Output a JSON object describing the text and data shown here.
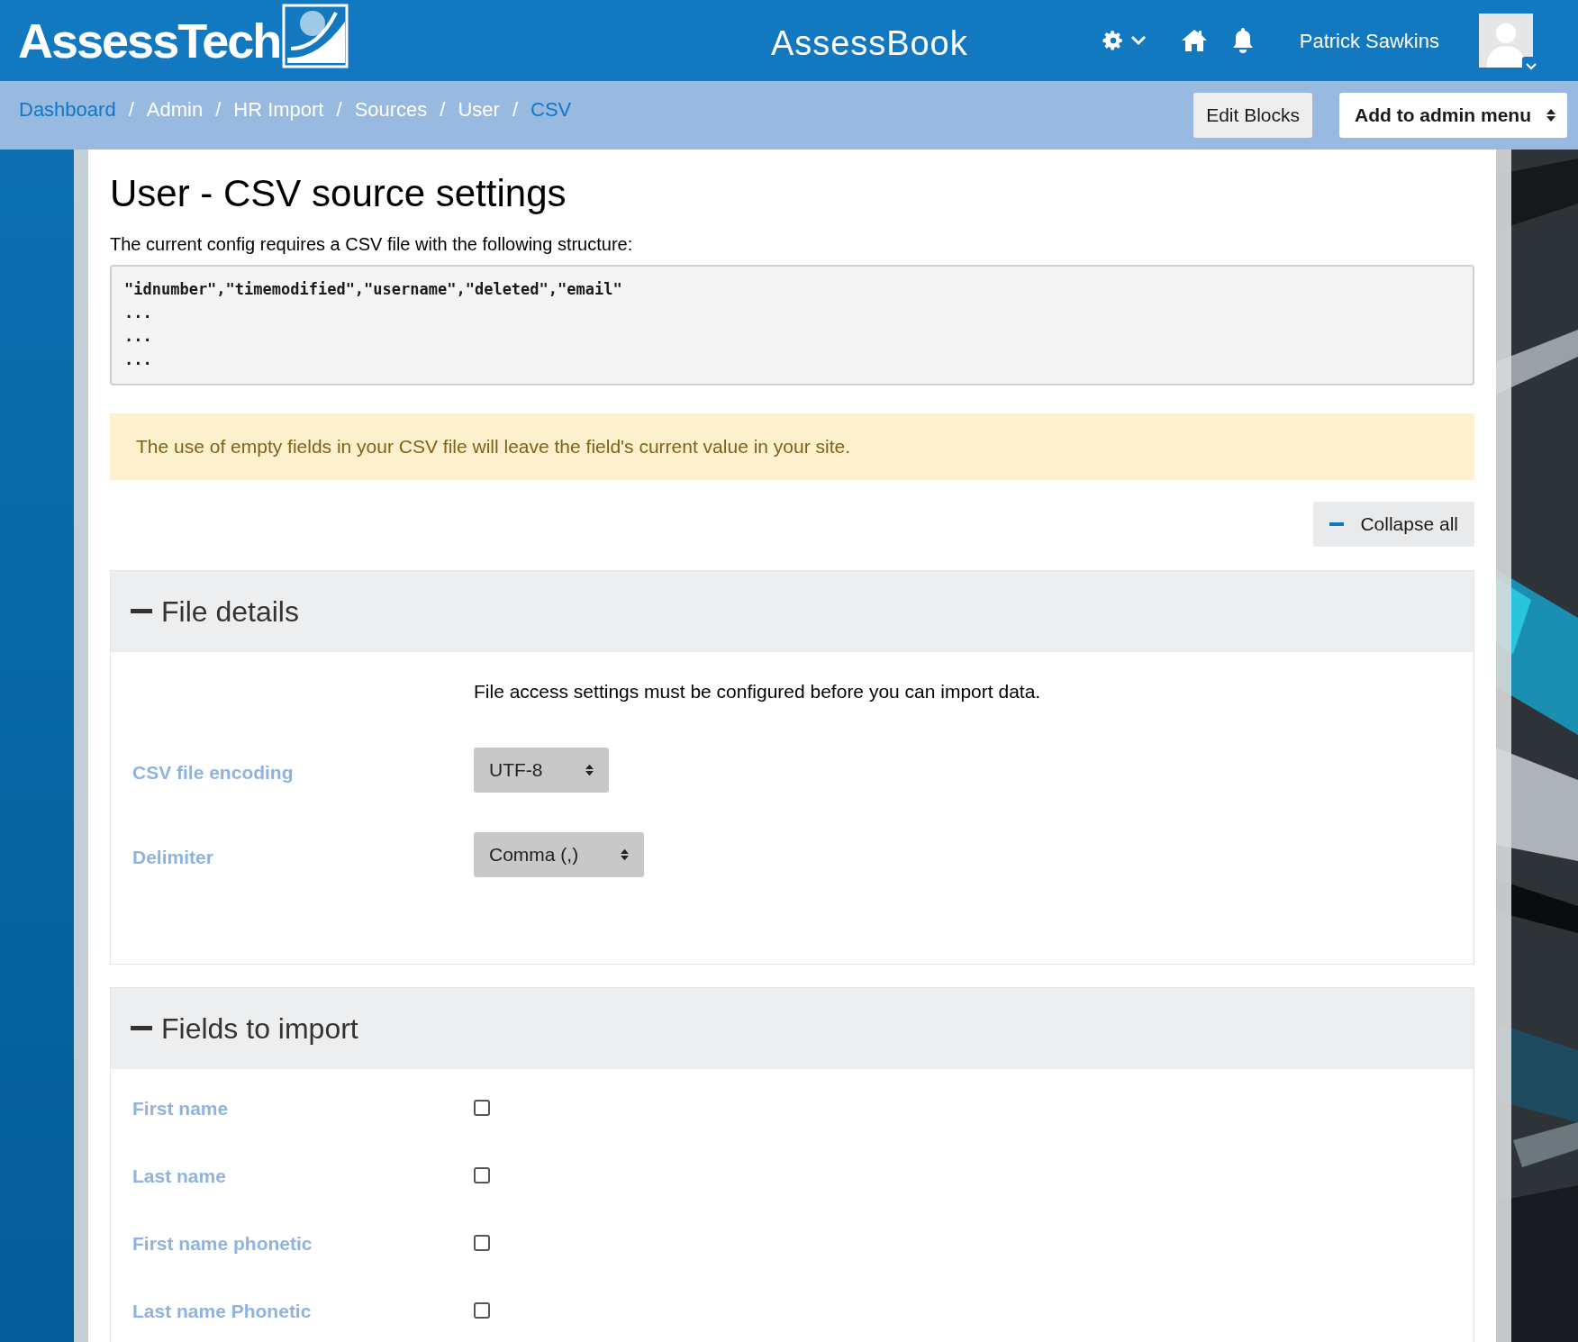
{
  "header": {
    "logo": "AssessTech",
    "site_name": "AssessBook",
    "user_name": "Patrick Sawkins"
  },
  "breadcrumbs": {
    "separator": "/",
    "items": [
      {
        "label": "Dashboard",
        "kind": "link"
      },
      {
        "label": "Admin",
        "kind": "plain"
      },
      {
        "label": "HR Import",
        "kind": "plain"
      },
      {
        "label": "Sources",
        "kind": "plain"
      },
      {
        "label": "User",
        "kind": "plain"
      },
      {
        "label": "CSV",
        "kind": "link"
      }
    ]
  },
  "edit_blocks": "Edit Blocks",
  "admin_menu": "Add to admin menu",
  "page": {
    "title": "User - CSV source settings",
    "intro": "The current config requires a CSV file with the following structure:",
    "csv_structure": [
      "\"idnumber\",\"timemodified\",\"username\",\"deleted\",\"email\"",
      "...",
      "...",
      "..."
    ],
    "alert": "The use of empty fields in your CSV file will leave the field's current value in your site.",
    "collapse_all": "Collapse all"
  },
  "sections": [
    {
      "title": "File details",
      "expanded": true,
      "note": "File access settings must be configured before you can import data.",
      "rows": [
        {
          "kind": "select",
          "label": "CSV file encoding",
          "value": "UTF-8"
        },
        {
          "kind": "select",
          "label": "Delimiter",
          "value": "Comma (,)"
        }
      ]
    },
    {
      "title": "Fields to import",
      "expanded": true,
      "rows": [
        {
          "kind": "checkbox",
          "label": "First name",
          "checked": false
        },
        {
          "kind": "checkbox",
          "label": "Last name",
          "checked": false
        },
        {
          "kind": "checkbox",
          "label": "First name phonetic",
          "checked": false
        },
        {
          "kind": "checkbox",
          "label": "Last name Phonetic",
          "checked": false
        }
      ]
    }
  ]
}
